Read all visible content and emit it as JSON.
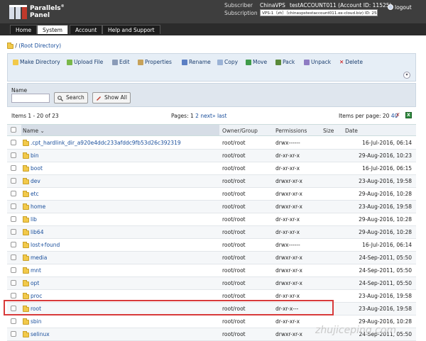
{
  "brand": {
    "line1": "Parallels",
    "reg": "®",
    "line2": "Panel"
  },
  "header": {
    "subscriber_label": "Subscriber",
    "subscriber_value": "ChinaVPS",
    "account_value": "testACCOUNT011 (Account ID: 11525)",
    "subscription_label": "Subscription",
    "subscription_value": "VPS-1（zh）（chinavpstestaccount011.ex-cloud.biz) ID: 25490",
    "logout": "logout"
  },
  "tabs": [
    {
      "label": "Home",
      "active": false
    },
    {
      "label": "System",
      "active": true
    },
    {
      "label": "Account",
      "active": false
    },
    {
      "label": "Help and Support",
      "active": false
    }
  ],
  "breadcrumb": {
    "prefix": "/",
    "link": "(Root Directory)"
  },
  "toolbar": {
    "make_directory": "Make Directory",
    "upload_file": "Upload File",
    "edit": "Edit",
    "properties": "Properties",
    "rename": "Rename",
    "copy": "Copy",
    "move": "Move",
    "pack": "Pack",
    "unpack": "Unpack",
    "delete": "Delete"
  },
  "filter": {
    "name_label": "Name",
    "name_value": "",
    "search": "Search",
    "show_all": "Show All"
  },
  "listing": {
    "items_text": "Items 1 - 20 of 23",
    "pages_label": "Pages:",
    "page1": "1",
    "page2": "2",
    "next": "next»",
    "last": "last",
    "per_page_label": "Items per page:",
    "per_page_20": "20",
    "per_page_40": "40"
  },
  "columns": {
    "name": "Name",
    "owner": "Owner/Group",
    "permissions": "Permissions",
    "size": "Size",
    "date": "Date"
  },
  "rows": [
    {
      "name": ".cpt_hardlink_dir_a920e4ddc233afddc9fb53d26c392319",
      "owner": "root/root",
      "perm": "drwx------",
      "date": "16-Jul-2016, 06:14"
    },
    {
      "name": "bin",
      "owner": "root/root",
      "perm": "dr-xr-xr-x",
      "date": "29-Aug-2016, 10:23"
    },
    {
      "name": "boot",
      "owner": "root/root",
      "perm": "dr-xr-xr-x",
      "date": "16-Jul-2016, 06:15"
    },
    {
      "name": "dev",
      "owner": "root/root",
      "perm": "drwxr-xr-x",
      "date": "23-Aug-2016, 19:58"
    },
    {
      "name": "etc",
      "owner": "root/root",
      "perm": "drwxr-xr-x",
      "date": "29-Aug-2016, 10:28"
    },
    {
      "name": "home",
      "owner": "root/root",
      "perm": "drwxr-xr-x",
      "date": "23-Aug-2016, 19:58"
    },
    {
      "name": "lib",
      "owner": "root/root",
      "perm": "dr-xr-xr-x",
      "date": "29-Aug-2016, 10:28"
    },
    {
      "name": "lib64",
      "owner": "root/root",
      "perm": "dr-xr-xr-x",
      "date": "29-Aug-2016, 10:28"
    },
    {
      "name": "lost+found",
      "owner": "root/root",
      "perm": "drwx------",
      "date": "16-Jul-2016, 06:14"
    },
    {
      "name": "media",
      "owner": "root/root",
      "perm": "drwxr-xr-x",
      "date": "24-Sep-2011, 05:50"
    },
    {
      "name": "mnt",
      "owner": "root/root",
      "perm": "drwxr-xr-x",
      "date": "24-Sep-2011, 05:50"
    },
    {
      "name": "opt",
      "owner": "root/root",
      "perm": "drwxr-xr-x",
      "date": "24-Sep-2011, 05:50"
    },
    {
      "name": "proc",
      "owner": "root/root",
      "perm": "dr-xr-xr-x",
      "date": "23-Aug-2016, 19:58"
    },
    {
      "name": "root",
      "owner": "root/root",
      "perm": "dr-xr-x---",
      "date": "23-Aug-2016, 19:58"
    },
    {
      "name": "sbin",
      "owner": "root/root",
      "perm": "dr-xr-xr-x",
      "date": "29-Aug-2016, 10:28"
    },
    {
      "name": "selinux",
      "owner": "root/root",
      "perm": "drwxr-xr-x",
      "date": "24-Sep-2011, 05:50"
    }
  ],
  "watermark": "zhujiceping.com",
  "colors": {
    "header_bg": "#3e3e3e",
    "link": "#1a4f9c",
    "highlight": "#d83a3a",
    "folder": "#f2c94a"
  }
}
